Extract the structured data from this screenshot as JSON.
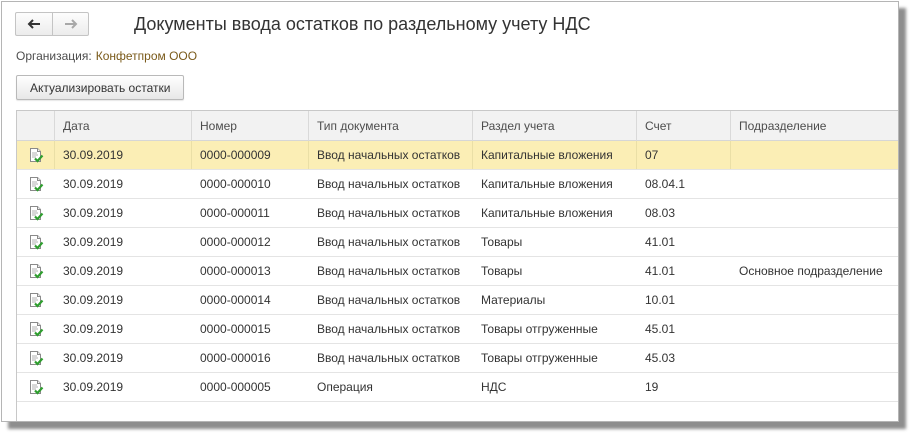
{
  "window": {
    "title": "Документы ввода остатков по раздельному учету НДС"
  },
  "nav": {
    "back_icon": "arrow-left-icon",
    "forward_icon": "arrow-right-icon"
  },
  "org": {
    "label": "Организация:",
    "value": "Конфетпром ООО"
  },
  "toolbar": {
    "refresh_label": "Актуализировать остатки"
  },
  "table": {
    "columns": [
      "",
      "Дата",
      "Номер",
      "Тип документа",
      "Раздел учета",
      "Счет",
      "Подразделение"
    ],
    "rows": [
      {
        "date": "30.09.2019",
        "number": "0000-000009",
        "type": "Ввод начальных остатков",
        "section": "Капитальные вложения",
        "account": "07",
        "division": ""
      },
      {
        "date": "30.09.2019",
        "number": "0000-000010",
        "type": "Ввод начальных остатков",
        "section": "Капитальные вложения",
        "account": "08.04.1",
        "division": ""
      },
      {
        "date": "30.09.2019",
        "number": "0000-000011",
        "type": "Ввод начальных остатков",
        "section": "Капитальные вложения",
        "account": "08.03",
        "division": ""
      },
      {
        "date": "30.09.2019",
        "number": "0000-000012",
        "type": "Ввод начальных остатков",
        "section": "Товары",
        "account": "41.01",
        "division": ""
      },
      {
        "date": "30.09.2019",
        "number": "0000-000013",
        "type": "Ввод начальных остатков",
        "section": "Товары",
        "account": "41.01",
        "division": "Основное подразделение"
      },
      {
        "date": "30.09.2019",
        "number": "0000-000014",
        "type": "Ввод начальных остатков",
        "section": "Материалы",
        "account": "10.01",
        "division": ""
      },
      {
        "date": "30.09.2019",
        "number": "0000-000015",
        "type": "Ввод начальных остатков",
        "section": "Товары отгруженные",
        "account": "45.01",
        "division": ""
      },
      {
        "date": "30.09.2019",
        "number": "0000-000016",
        "type": "Ввод начальных остатков",
        "section": "Товары отгруженные",
        "account": "45.03",
        "division": ""
      },
      {
        "date": "30.09.2019",
        "number": "0000-000005",
        "type": "Операция",
        "section": "НДС",
        "account": "19",
        "division": ""
      }
    ],
    "selected_row": 0,
    "row_icon": "posted-document-icon"
  },
  "colors": {
    "selection": "#fbeeb5",
    "org_value": "#7a5a1a"
  }
}
